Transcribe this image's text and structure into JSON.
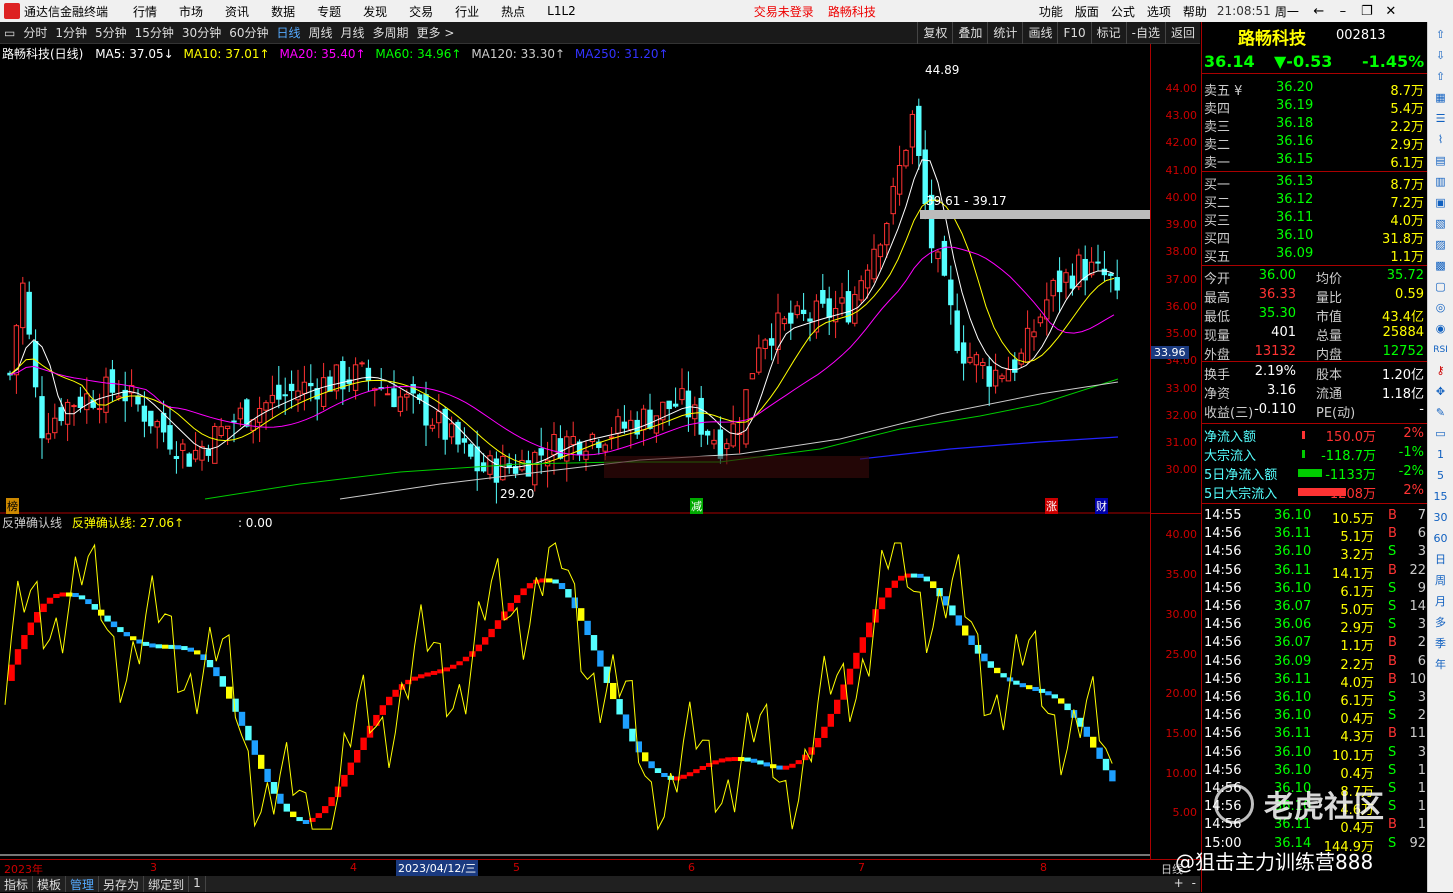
{
  "title": {
    "app_name": "通达信金融终端",
    "menus": [
      "行情",
      "市场",
      "资讯",
      "数据",
      "专题",
      "发现",
      "交易",
      "行业",
      "热点",
      "L1L2"
    ],
    "trade_status": "交易未登录",
    "stock_link": "路畅科技",
    "right_menus": [
      "功能",
      "版面",
      "公式",
      "选项",
      "帮助"
    ],
    "clock": "21:08:51",
    "weekday": "周一"
  },
  "toolbar": {
    "periods": [
      "分时",
      "1分钟",
      "5分钟",
      "15分钟",
      "30分钟",
      "60分钟",
      "日线",
      "周线",
      "月线",
      "多周期",
      "更多 >"
    ],
    "active": "日线",
    "right": [
      "复权",
      "叠加",
      "统计",
      "画线",
      "F10",
      "标记",
      "-自选",
      "返回"
    ]
  },
  "chart": {
    "header": "路畅科技(日线)",
    "ma": [
      {
        "label": "MA5: 37.05↓",
        "color": "#ffffff"
      },
      {
        "label": "MA10: 37.01↑",
        "color": "#ffff00"
      },
      {
        "label": "MA20: 35.40↑",
        "color": "#ff00ff"
      },
      {
        "label": "MA60: 34.96↑",
        "color": "#00ff00"
      },
      {
        "label": "MA120: 33.30↑",
        "color": "#cccccc"
      },
      {
        "label": "MA250: 31.20↑",
        "color": "#0000ff"
      }
    ],
    "high_label": "44.89",
    "low_label": "29.20",
    "range_label": "39.61 - 39.17",
    "markers": [
      "榜",
      "减",
      "涨",
      "财"
    ],
    "price_tag": "33.96",
    "yaxis": [
      "44.00",
      "43.00",
      "42.00",
      "41.00",
      "40.00",
      "39.00",
      "38.00",
      "37.00",
      "36.00",
      "35.00",
      "34.00",
      "33.00",
      "32.00",
      "31.00",
      "30.00"
    ]
  },
  "indicator": {
    "name": "反弹确认线",
    "value_label": "反弹确认线: 27.06↑",
    "extra": ": 0.00",
    "yaxis": [
      "40.00",
      "35.00",
      "30.00",
      "25.00",
      "20.00",
      "15.00",
      "10.00",
      "5.00"
    ]
  },
  "dates": {
    "items": [
      "2023年",
      "3",
      "4",
      "2023/04/12/三",
      "5",
      "6",
      "7",
      "8"
    ],
    "right": "日线"
  },
  "bottom": {
    "tabs": [
      "指标",
      "模板",
      "管理",
      "另存为",
      "绑定到",
      "1"
    ],
    "active": "管理"
  },
  "quote": {
    "name": "路畅科技",
    "code": "002813",
    "price": "36.14",
    "change": "▼-0.53",
    "pct": "-1.45%",
    "asks": [
      {
        "l": "卖五 ¥",
        "p": "36.20",
        "v": "8.7万"
      },
      {
        "l": "卖四",
        "p": "36.19",
        "v": "5.4万"
      },
      {
        "l": "卖三",
        "p": "36.18",
        "v": "2.2万"
      },
      {
        "l": "卖二",
        "p": "36.16",
        "v": "2.9万"
      },
      {
        "l": "卖一",
        "p": "36.15",
        "v": "6.1万"
      }
    ],
    "bids": [
      {
        "l": "买一",
        "p": "36.13",
        "v": "8.7万"
      },
      {
        "l": "买二",
        "p": "36.12",
        "v": "7.2万"
      },
      {
        "l": "买三",
        "p": "36.11",
        "v": "4.0万"
      },
      {
        "l": "买四",
        "p": "36.10",
        "v": "31.8万"
      },
      {
        "l": "买五",
        "p": "36.09",
        "v": "1.1万"
      }
    ],
    "stats": [
      [
        "今开",
        "36.00",
        "均价",
        "35.72"
      ],
      [
        "最高",
        "36.33",
        "量比",
        "0.59"
      ],
      [
        "最低",
        "35.30",
        "市值",
        "43.4亿"
      ],
      [
        "现量",
        "401",
        "总量",
        "25884"
      ],
      [
        "外盘",
        "13132",
        "内盘",
        "12752"
      ]
    ],
    "stats2": [
      [
        "换手",
        "2.19%",
        "股本",
        "1.20亿"
      ],
      [
        "净资",
        "3.16",
        "流通",
        "1.18亿"
      ],
      [
        "收益(三)",
        "-0.110",
        "PE(动)",
        "-"
      ]
    ],
    "flows": [
      [
        "净流入额",
        "150.0万",
        "2%"
      ],
      [
        "大宗流入",
        "-118.7万",
        "-1%"
      ],
      [
        "5日净流入额",
        "-1133万",
        "-2%"
      ],
      [
        "5日大宗流入",
        "1208万",
        "2%"
      ]
    ],
    "ticks": [
      [
        "14:55",
        "36.10",
        "10.5万",
        "B",
        "7"
      ],
      [
        "14:56",
        "36.11",
        "5.1万",
        "B",
        "6"
      ],
      [
        "14:56",
        "36.10",
        "3.2万",
        "S",
        "3"
      ],
      [
        "14:56",
        "36.11",
        "14.1万",
        "B",
        "22"
      ],
      [
        "14:56",
        "36.10",
        "6.1万",
        "S",
        "9"
      ],
      [
        "14:56",
        "36.07",
        "5.0万",
        "S",
        "14"
      ],
      [
        "14:56",
        "36.06",
        "2.9万",
        "S",
        "3"
      ],
      [
        "14:56",
        "36.07",
        "1.1万",
        "B",
        "2"
      ],
      [
        "14:56",
        "36.09",
        "2.2万",
        "B",
        "6"
      ],
      [
        "14:56",
        "36.11",
        "4.0万",
        "B",
        "10"
      ],
      [
        "14:56",
        "36.10",
        "6.1万",
        "S",
        "3"
      ],
      [
        "14:56",
        "36.10",
        "0.4万",
        "S",
        "2"
      ],
      [
        "14:56",
        "36.11",
        "4.3万",
        "B",
        "11"
      ],
      [
        "14:56",
        "36.10",
        "10.1万",
        "S",
        "3"
      ],
      [
        "14:56",
        "36.10",
        "0.4万",
        "S",
        "1"
      ],
      [
        "14:56",
        "36.10",
        "8.7万",
        "S",
        "1"
      ],
      [
        "14:56",
        "36.10",
        "4.6万",
        "S",
        "1"
      ],
      [
        "14:56",
        "36.11",
        "0.4万",
        "B",
        "1"
      ],
      [
        "15:00",
        "36.14",
        "144.9万",
        "S",
        "92"
      ]
    ]
  },
  "watermark": {
    "community": "老虎社区",
    "author": "@狙击主力训练营888"
  },
  "sidebar": {
    "labels": [
      "RSI",
      "1",
      "5",
      "15",
      "30",
      "60",
      "日",
      "周",
      "月",
      "多",
      "季",
      "年"
    ]
  }
}
